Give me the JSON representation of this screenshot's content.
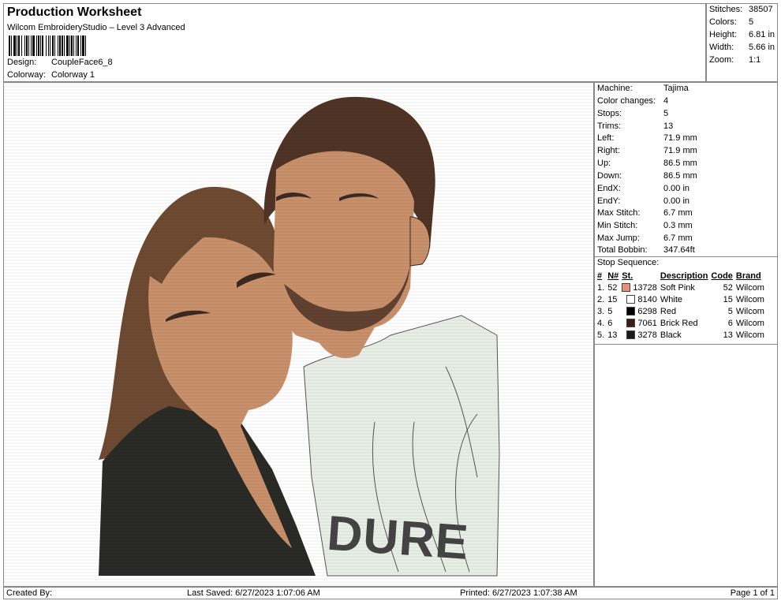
{
  "header": {
    "title": "Production Worksheet",
    "subtitle": "Wilcom EmbroideryStudio – Level 3 Advanced",
    "design_label": "Design:",
    "design_value": "CoupleFace6_8",
    "colorway_label": "Colorway:",
    "colorway_value": "Colorway 1"
  },
  "stats": [
    {
      "label": "Stitches:",
      "value": "38507"
    },
    {
      "label": "Colors:",
      "value": "5"
    },
    {
      "label": "Height:",
      "value": "6.81 in"
    },
    {
      "label": "Width:",
      "value": "5.66 in"
    },
    {
      "label": "Zoom:",
      "value": "1:1"
    }
  ],
  "details": [
    {
      "label": "Machine:",
      "value": "Tajima"
    },
    {
      "label": "Color changes:",
      "value": "4"
    },
    {
      "label": "Stops:",
      "value": "5"
    },
    {
      "label": "Trims:",
      "value": "13"
    },
    {
      "label": "Left:",
      "value": "71.9 mm"
    },
    {
      "label": "Right:",
      "value": "71.9 mm"
    },
    {
      "label": "Up:",
      "value": "86.5 mm"
    },
    {
      "label": "Down:",
      "value": "86.5 mm"
    },
    {
      "label": "EndX:",
      "value": "0.00 in"
    },
    {
      "label": "EndY:",
      "value": "0.00 in"
    },
    {
      "label": "Max Stitch:",
      "value": "6.7 mm"
    },
    {
      "label": "Min Stitch:",
      "value": "0.3 mm"
    },
    {
      "label": "Max Jump:",
      "value": "6.7 mm"
    },
    {
      "label": "Total Bobbin:",
      "value": "347.64ft"
    }
  ],
  "stop_sequence": {
    "title": "Stop Sequence:",
    "headers": [
      "#",
      "N#",
      "St.",
      "Description",
      "Code",
      "Brand"
    ],
    "rows": [
      {
        "idx": "1.",
        "n": "52",
        "color": "#e8907a",
        "st": "13728",
        "desc": "Soft Pink",
        "code": "52",
        "brand": "Wilcom"
      },
      {
        "idx": "2.",
        "n": "15",
        "color": "#ffffff",
        "st": "8140",
        "desc": "White",
        "code": "15",
        "brand": "Wilcom"
      },
      {
        "idx": "3.",
        "n": "5",
        "color": "#000000",
        "st": "6298",
        "desc": "Red",
        "code": "5",
        "brand": "Wilcom"
      },
      {
        "idx": "4.",
        "n": "6",
        "color": "#3a1e14",
        "st": "7061",
        "desc": "Brick Red",
        "code": "6",
        "brand": "Wilcom"
      },
      {
        "idx": "5.",
        "n": "13",
        "color": "#1a1a1a",
        "st": "3278",
        "desc": "Black",
        "code": "13",
        "brand": "Wilcom"
      }
    ]
  },
  "footer": {
    "created_by": "Created By:",
    "last_saved": "Last Saved: 6/27/2023 1:07:06 AM",
    "printed": "Printed: 6/27/2023 1:07:38 AM",
    "page": "Page 1 of 1"
  },
  "design_preview": {
    "shirt_text": "DURE"
  },
  "colors": {
    "skin": "#c9906c",
    "hair_woman": "#6e4a32",
    "hair_man": "#4f3425",
    "shirt_man": "#e8efe6",
    "jacket_woman": "#2a2a26"
  }
}
